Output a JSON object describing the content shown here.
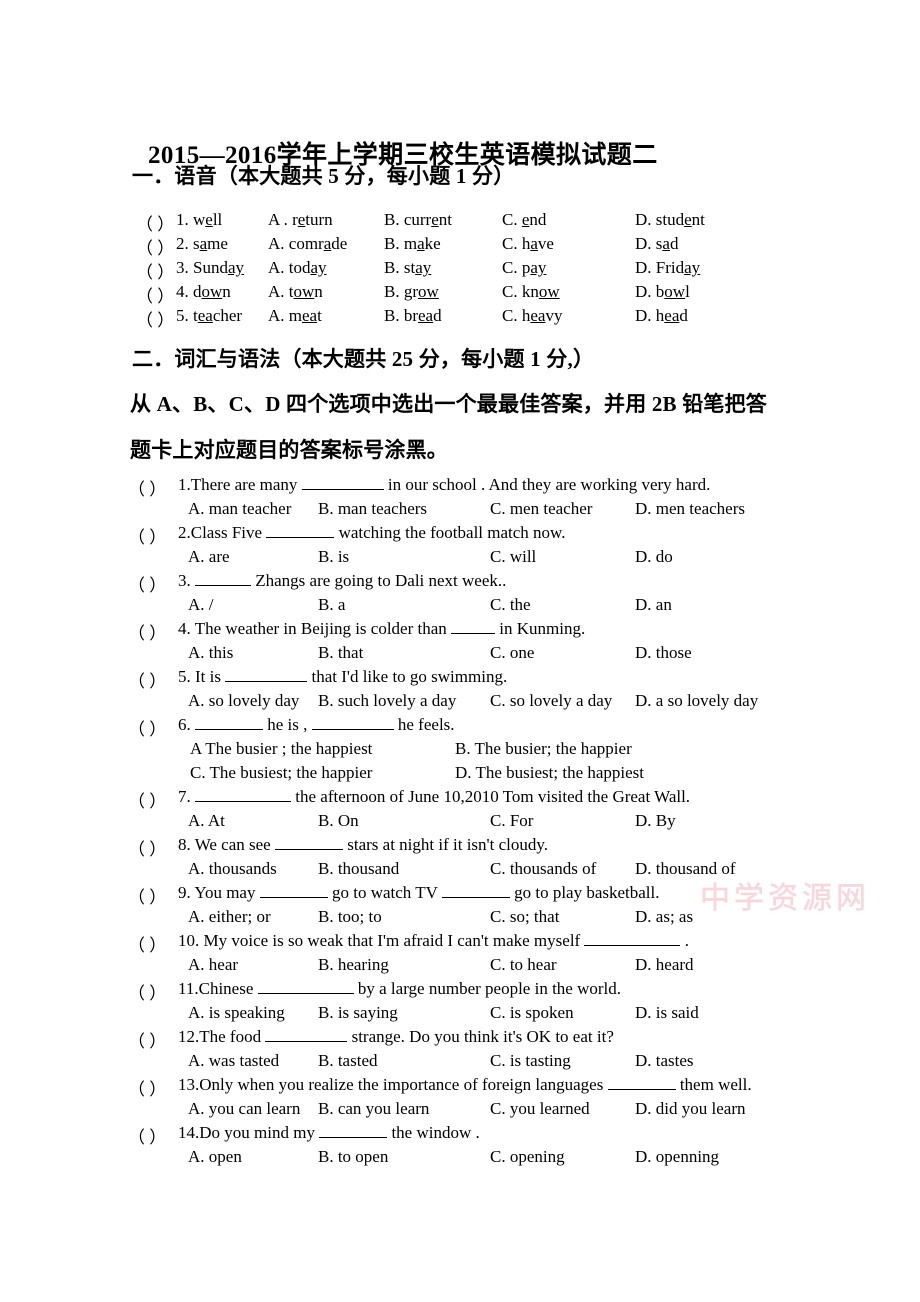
{
  "document": {
    "title": "2015—2016学年上学期三校生英语模拟试题二",
    "watermark": "中学资源网"
  },
  "section_one": {
    "heading": "一．语音（本大题共 5 分，每小题 1 分）",
    "items": [
      {
        "mark": "（    ）",
        "number": "1.",
        "stem_pre": "w",
        "stem_u": "e",
        "stem_post": "ll",
        "a_label": "A .",
        "a_pre": "r",
        "a_u": "e",
        "a_post": "turn",
        "b_label": "B.",
        "b_pre": "curr",
        "b_u": "e",
        "b_post": "nt",
        "c_label": "C.",
        "c_pre": "",
        "c_u": "e",
        "c_post": "nd",
        "d_label": "D.",
        "d_pre": "stud",
        "d_u": "e",
        "d_post": "nt"
      },
      {
        "mark": "（    ）",
        "number": "2.",
        "stem_pre": "s",
        "stem_u": "a",
        "stem_post": "me",
        "a_label": "A.",
        "a_pre": "comr",
        "a_u": "a",
        "a_post": "de",
        "b_label": "B.",
        "b_pre": "m",
        "b_u": "a",
        "b_post": "ke",
        "c_label": "C.",
        "c_pre": "h",
        "c_u": "a",
        "c_post": "ve",
        "d_label": "D.",
        "d_pre": "s",
        "d_u": "a",
        "d_post": "d"
      },
      {
        "mark": "（    ）",
        "number": "3.",
        "stem_pre": "Sund",
        "stem_u": "ay",
        "stem_post": "",
        "a_label": "A.",
        "a_pre": "tod",
        "a_u": "ay",
        "a_post": "",
        "b_label": "B.",
        "b_pre": "st",
        "b_u": "ay",
        "b_post": "",
        "c_label": "C.",
        "c_pre": "p",
        "c_u": "ay",
        "c_post": "",
        "d_label": "D.",
        "d_pre": "Frid",
        "d_u": "ay",
        "d_post": ""
      },
      {
        "mark": "（    ）",
        "number": "4.",
        "stem_pre": "d",
        "stem_u": "ow",
        "stem_post": "n",
        "a_label": "A.",
        "a_pre": "t",
        "a_u": "ow",
        "a_post": "n",
        "b_label": "B.",
        "b_pre": "gr",
        "b_u": "ow",
        "b_post": "",
        "c_label": "C.",
        "c_pre": "kn",
        "c_u": "ow",
        "c_post": "",
        "d_label": "D.",
        "d_pre": "b",
        "d_u": "ow",
        "d_post": "l"
      },
      {
        "mark": "（    ）",
        "number": "5.",
        "stem_pre": "t",
        "stem_u": "ea",
        "stem_post": "cher",
        "a_label": "A.",
        "a_pre": "m",
        "a_u": "ea",
        "a_post": "t",
        "b_label": "B.",
        "b_pre": "br",
        "b_u": "ea",
        "b_post": "d",
        "c_label": "C.",
        "c_pre": "h",
        "c_u": "ea",
        "c_post": "vy",
        "d_label": "D.",
        "d_pre": "h",
        "d_u": "ea",
        "d_post": "d"
      }
    ]
  },
  "section_two": {
    "heading": "二．词汇与语法（本大题共 25 分，每小题 1 分,）",
    "instruction_line_1": "从 A、B、C、D 四个选项中选出一个最最佳答案，并用 2B 铅笔把答",
    "instruction_line_2": "题卡上对应题目的答案标号涂黑。",
    "questions": [
      {
        "mark": "（    ）",
        "stem_before": "1.There are many",
        "blank": "bl-l",
        "stem_after": "in our school . And they are working very hard.",
        "options": [
          "A. man teacher",
          "B. man teachers",
          "C. men teacher",
          "D. men teachers"
        ],
        "layout": "four"
      },
      {
        "mark": "（    ）",
        "stem_before": "2.Class Five",
        "blank": "bl-m",
        "stem_after": "watching the football match now.",
        "options": [
          "A. are",
          "B.   is",
          "C.   will",
          "D.   do"
        ],
        "layout": "four"
      },
      {
        "mark": "（    ）",
        "stem_before": "3.",
        "blank": "bl-s",
        "stem_after": "Zhangs are going to Dali next week..",
        "options": [
          "A.   /",
          "B. a",
          "C. the",
          "D. an"
        ],
        "layout": "four"
      },
      {
        "mark": "（    ）",
        "stem_before": "4.   The weather in Beijing is colder than",
        "blank": "bl-xs",
        "stem_after": "in Kunming.",
        "options": [
          "A. this",
          "B. that",
          "C. one",
          "D. those"
        ],
        "layout": "four"
      },
      {
        "mark": "（    ）",
        "stem_before": "5.   It is",
        "blank": "bl-l",
        "stem_after": "that I'd like to go swimming.",
        "options": [
          "A. so lovely day",
          "B. such lovely a day",
          "C. so lovely a day",
          "D. a so lovely day"
        ],
        "layout": "four"
      },
      {
        "mark": "（    ）",
        "stem_before": "6.",
        "blank": "bl-m",
        "stem_mid": "he is ,",
        "blank2": "bl-l",
        "stem_after": "he feels.",
        "options": [
          "A   The busier ; the happiest",
          "B. The busier; the happier",
          "C.   The busiest; the happier",
          "D. The busiest; the happiest"
        ],
        "layout": "two-by-two"
      },
      {
        "mark": "（    ）",
        "stem_before": "7.",
        "blank": "bl-xl",
        "stem_after": "the afternoon of June 10,2010 Tom visited the Great Wall.",
        "options": [
          "A. At",
          "B. On",
          "C. For",
          "D. By"
        ],
        "layout": "four"
      },
      {
        "mark": "（    ）",
        "stem_before": "8. We can see",
        "blank": "bl-m",
        "stem_after": "stars at night if it isn't cloudy.",
        "options": [
          "A. thousands",
          "B. thousand",
          "C. thousands of",
          "D. thousand of"
        ],
        "layout": "four"
      },
      {
        "mark": "（    ）",
        "stem_before": "9. You may",
        "blank": "bl-m",
        "stem_mid": "go to watch TV",
        "blank2": "bl-m",
        "stem_after": "go to play basketball.",
        "options": [
          "A. either; or",
          "B. too; to",
          "C. so; that",
          "D. as; as"
        ],
        "layout": "four"
      },
      {
        "mark": "（    ）",
        "stem_before": "10. My voice is so weak that I'm afraid I can't make myself",
        "blank": "bl-xl",
        "stem_after": ".",
        "options": [
          "A. hear",
          "B. hearing",
          "C. to hear",
          "D. heard"
        ],
        "layout": "four"
      },
      {
        "mark": "（    ）",
        "stem_before": "11.Chinese",
        "blank": "bl-xl",
        "stem_after": "by a large number people in the world.",
        "options": [
          "A. is speaking",
          "B. is saying",
          "C. is spoken",
          "D. is said"
        ],
        "layout": "four"
      },
      {
        "mark": "（    ）",
        "stem_before": "12.The food",
        "blank": "bl-l",
        "stem_after": "strange. Do you think it's OK to eat it?",
        "options": [
          "A. was   tasted",
          "B. tasted",
          "C. is tasting",
          "D. tastes"
        ],
        "layout": "four"
      },
      {
        "mark": "（    ）",
        "stem_before": "13.Only when you realize the importance of foreign languages",
        "blank": "bl-m",
        "stem_after": "them well.",
        "options": [
          "A. you can learn",
          "B. can you learn",
          "C. you learned",
          "D. did you learn"
        ],
        "layout": "four"
      },
      {
        "mark": "（    ）",
        "stem_before": "14.Do you mind my",
        "blank": "bl-m",
        "stem_after": "the window .",
        "options": [
          "A. open",
          "B. to open",
          "C. opening",
          "D. openning"
        ],
        "layout": "four"
      }
    ]
  }
}
